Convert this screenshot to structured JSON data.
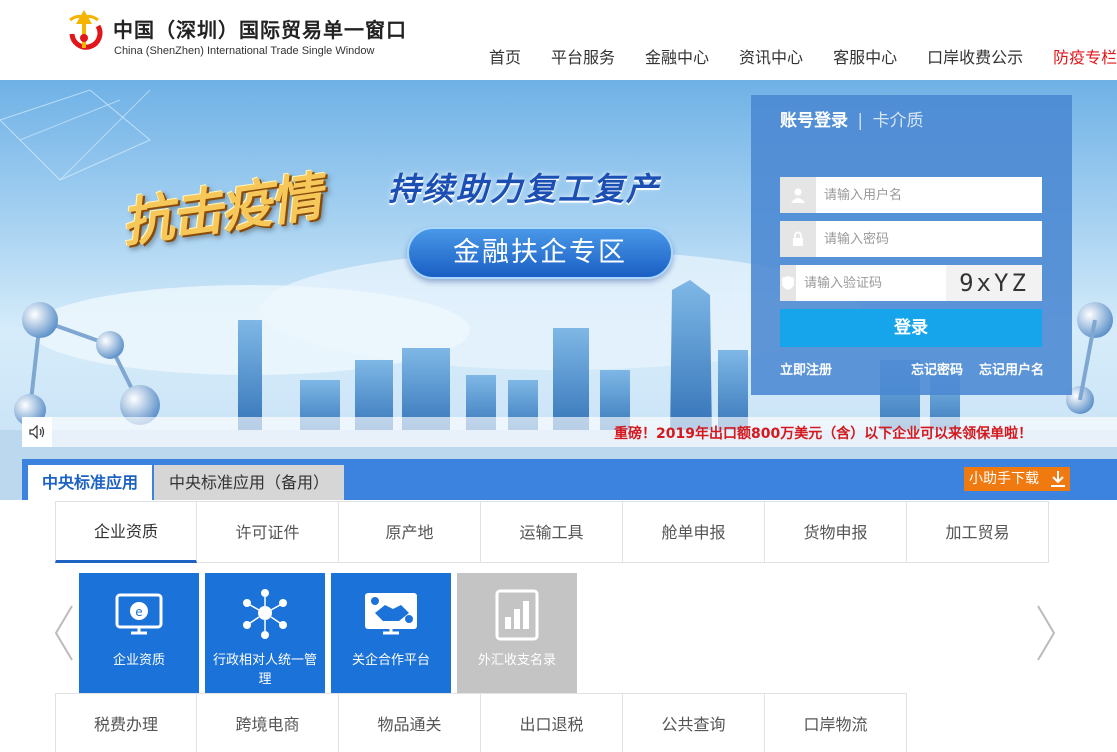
{
  "header": {
    "title": "中国（深圳）国际贸易单一窗口",
    "subtitle": "China (ShenZhen) International Trade Single Window",
    "nav": [
      {
        "label": "首页"
      },
      {
        "label": "平台服务"
      },
      {
        "label": "金融中心"
      },
      {
        "label": "资讯中心"
      },
      {
        "label": "客服中心"
      },
      {
        "label": "口岸收费公示"
      },
      {
        "label": "防疫专栏",
        "color": "#e0161b"
      }
    ]
  },
  "banner": {
    "fight_text": "抗击疫情",
    "slogan": "持续助力复工复产",
    "cta": "金融扶企专区"
  },
  "login": {
    "tab_active": "账号登录",
    "separator": "|",
    "tab_other": "卡介质",
    "username_placeholder": "请输入用户名",
    "password_placeholder": "请输入密码",
    "code_placeholder": "请输入验证码",
    "captcha": "9xYZ",
    "submit": "登录",
    "register": "立即注册",
    "forgot_password": "忘记密码",
    "forgot_username": "忘记用户名",
    "button_color": "#16a5ea"
  },
  "ticker": {
    "text": "重磅！2019年出口额800万美元（含）以下企业可以来领保单啦！",
    "icon": "speaker-icon"
  },
  "apps": {
    "tab_active": "中央标准应用",
    "tab_other": "中央标准应用（备用）",
    "helper": "小助手下载"
  },
  "categories_row1": [
    "企业资质",
    "许可证件",
    "原产地",
    "运输工具",
    "舱单申报",
    "货物申报",
    "加工贸易"
  ],
  "categories_row2": [
    "税费办理",
    "跨境电商",
    "物品通关",
    "出口退税",
    "公共查询",
    "口岸物流"
  ],
  "tiles": [
    {
      "label": "企业资质",
      "icon": "certificate-monitor-icon"
    },
    {
      "label": "行政相对人统一管理",
      "icon": "people-network-icon"
    },
    {
      "label": "关企合作平台",
      "icon": "handshake-icon"
    },
    {
      "label": "外汇收支名录",
      "icon": "book-chart-icon"
    }
  ],
  "colors": {
    "primary": "#1b72d8",
    "tab_bar": "#3c83e0",
    "accent_orange": "#f07a10",
    "alert_red": "#d4181e"
  }
}
